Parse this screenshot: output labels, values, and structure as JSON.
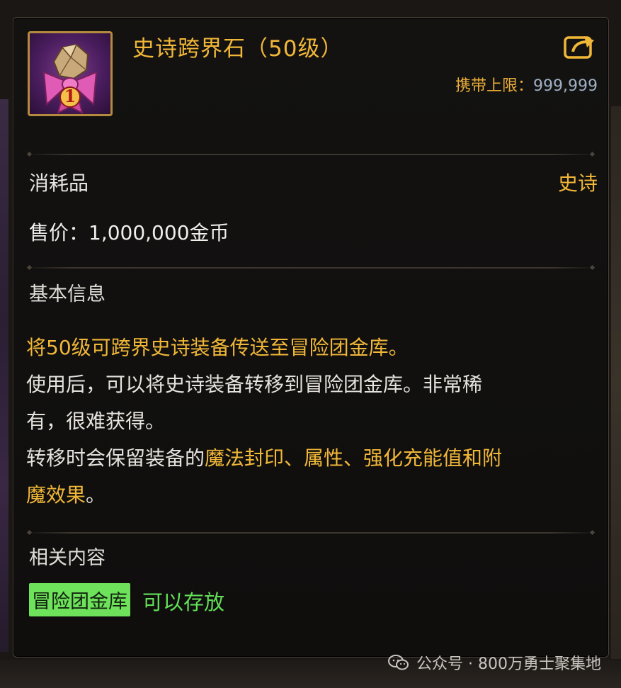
{
  "item": {
    "name": "史诗跨界石（50级）",
    "carry_limit_label": "携带上限：",
    "carry_limit_value": "999,999",
    "icon": "epic-crossing-stone-icon",
    "icon_badge": "1"
  },
  "info": {
    "type": "消耗品",
    "rarity": "史诗",
    "price": "售价：1,000,000金币"
  },
  "basic_info": {
    "title": "基本信息",
    "line1": "将50级可跨界史诗装备传送至冒险团金库。",
    "line2": "使用后，可以将史诗装备转移到冒险团金库。非常稀",
    "line3": "有，很难获得。",
    "line4_prefix": "转移时会保留装备的",
    "line4_highlight": "魔法封印、属性、强化充能值和附",
    "line5_highlight": "魔效果",
    "line5_suffix": "。"
  },
  "related": {
    "title": "相关内容",
    "storage_tag": "冒险团金库",
    "storage_status": "可以存放"
  },
  "watermark": {
    "text": "公众号 · 800万勇士聚集地",
    "icon": "wechat-icon"
  },
  "colors": {
    "gold": "#f1b738",
    "green": "#62e056",
    "tag_bg": "#6ee25a",
    "carry_value": "#9fb0c4"
  }
}
